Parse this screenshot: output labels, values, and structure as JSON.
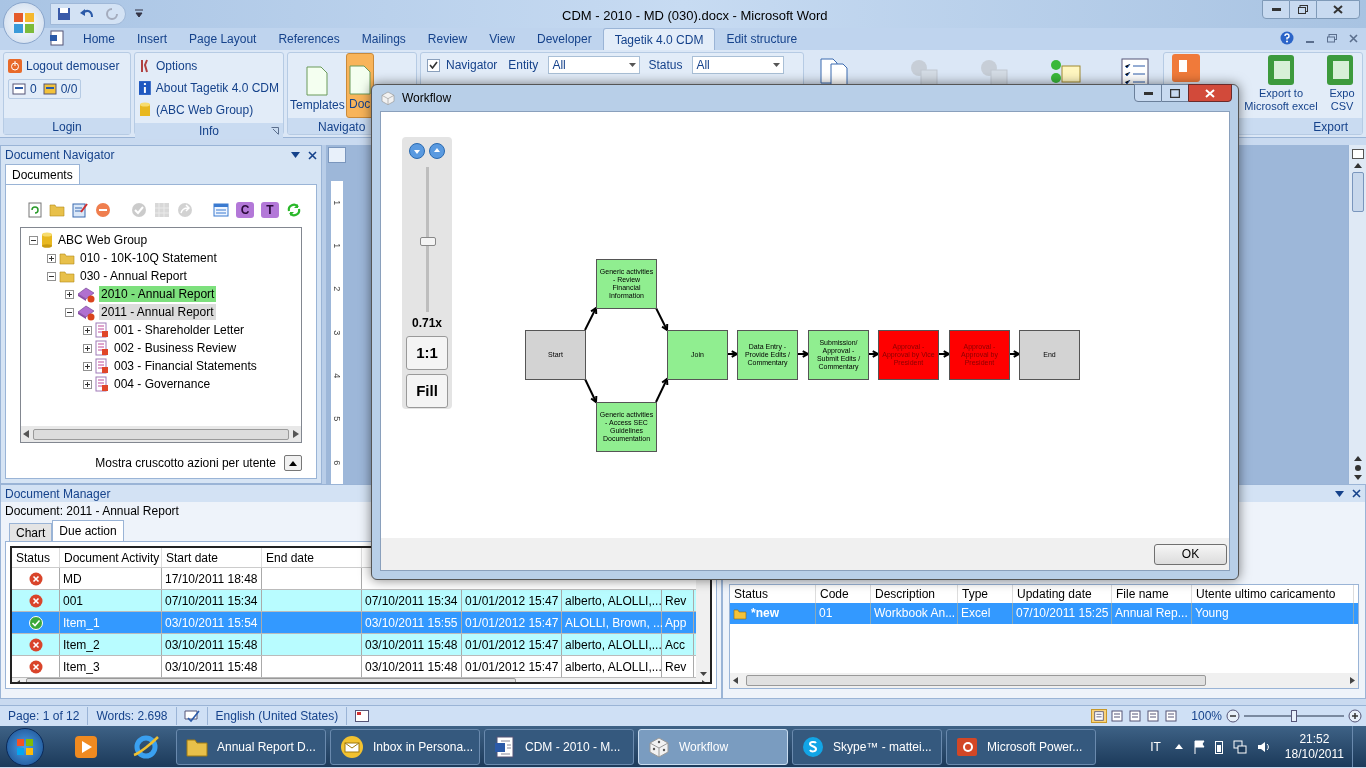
{
  "window": {
    "title": "CDM - 2010 - MD (030).docx - Microsoft Word"
  },
  "ribbon_tabs": [
    {
      "label": "Home",
      "selected": false
    },
    {
      "label": "Insert",
      "selected": false
    },
    {
      "label": "Page Layout",
      "selected": false
    },
    {
      "label": "References",
      "selected": false
    },
    {
      "label": "Mailings",
      "selected": false
    },
    {
      "label": "Review",
      "selected": false
    },
    {
      "label": "View",
      "selected": false
    },
    {
      "label": "Developer",
      "selected": false
    },
    {
      "label": "Tagetik 4.0 CDM",
      "selected": true
    },
    {
      "label": "Edit structure",
      "selected": false
    }
  ],
  "ribbon": {
    "login": {
      "logout": "Logout demouser",
      "counters": [
        "0",
        "0/0"
      ],
      "group": "Login"
    },
    "info": {
      "items": [
        "Options",
        "About Tagetik 4.0 CDM",
        "(ABC Web Group)"
      ],
      "group": "Info"
    },
    "navigator": {
      "buttons": [
        {
          "label": "Templates",
          "selected": false
        },
        {
          "label": "Doc",
          "selected": true
        }
      ],
      "group": "Navigato"
    },
    "filters": {
      "navigator": {
        "label": "Navigator",
        "checked": true
      },
      "entity": {
        "label": "Entity",
        "value": "All"
      },
      "status": {
        "label": "Status",
        "value": "All"
      }
    },
    "export": {
      "buttons": [
        "Export to Microsoft excel",
        "Expo CSV"
      ],
      "group": "Export"
    }
  },
  "document_navigator": {
    "title": "Document Navigator",
    "tabs": [
      {
        "label": "Documents",
        "selected": true
      }
    ],
    "toolbar": [
      {
        "kind": "refresh",
        "disabled": false
      },
      {
        "kind": "folder",
        "disabled": false
      },
      {
        "kind": "edit",
        "disabled": false
      },
      {
        "kind": "remove",
        "disabled": false
      },
      {
        "kind": "check",
        "disabled": true
      },
      {
        "kind": "grid",
        "disabled": true
      },
      {
        "kind": "forward",
        "disabled": true
      },
      {
        "kind": "list",
        "disabled": false
      },
      {
        "kind": "badge",
        "label": "C",
        "disabled": false
      },
      {
        "kind": "badge",
        "label": "T",
        "disabled": false
      },
      {
        "kind": "sync",
        "disabled": false
      }
    ],
    "tree": [
      {
        "label": "ABC Web Group",
        "kind": "database",
        "expanded": true,
        "selected": false,
        "highlighted": false,
        "children": [
          {
            "label": "010 - 10K-10Q Statement",
            "kind": "folder",
            "expanded": false,
            "selected": false,
            "highlighted": false
          },
          {
            "label": "030 - Annual Report",
            "kind": "folder",
            "expanded": true,
            "selected": false,
            "highlighted": false,
            "children": [
              {
                "label": "2010 - Annual Report",
                "kind": "report",
                "expanded": false,
                "selected": false,
                "highlighted": true
              },
              {
                "label": "2011 - Annual Report",
                "kind": "report",
                "expanded": true,
                "selected": true,
                "highlighted": false,
                "children": [
                  {
                    "label": "001 - Shareholder Letter",
                    "kind": "section",
                    "expanded": false,
                    "selected": false,
                    "highlighted": false
                  },
                  {
                    "label": "002 - Business Review",
                    "kind": "section",
                    "expanded": false,
                    "selected": false,
                    "highlighted": false
                  },
                  {
                    "label": "003 - Financial Statements",
                    "kind": "section",
                    "expanded": false,
                    "selected": false,
                    "highlighted": false
                  },
                  {
                    "label": "004 - Governance",
                    "kind": "section",
                    "expanded": false,
                    "selected": false,
                    "highlighted": false
                  }
                ]
              }
            ]
          }
        ]
      }
    ],
    "footer": "Mostra cruscotto azioni per utente"
  },
  "ruler": [
    "1",
    "1",
    "2",
    "3",
    "4",
    "5",
    "6"
  ],
  "document_manager": {
    "title": "Document Manager",
    "document": "Document: 2011 - Annual Report",
    "tabs": [
      {
        "label": "Chart",
        "selected": false
      },
      {
        "label": "Due action",
        "selected": true
      }
    ],
    "columns": [
      "Status",
      "Document Activity",
      "Start date",
      "End date"
    ],
    "rows": [
      {
        "kind": "error",
        "selected": false,
        "highlighted": false,
        "activity": "MD",
        "start": "17/10/2011 18:48"
      },
      {
        "kind": "error",
        "selected": false,
        "highlighted": true,
        "activity": "001",
        "start": "07/10/2011 15:34",
        "cells": [
          "07/10/2011 15:34",
          "01/01/2012 15:47",
          "alberto, ALOLLI,...",
          "Rev"
        ]
      },
      {
        "kind": "ok",
        "selected": true,
        "highlighted": false,
        "activity": "Item_1",
        "start": "03/10/2011 15:54",
        "cells": [
          "03/10/2011 15:55",
          "01/01/2012 15:47",
          "ALOLLI, Brown, ...",
          "App"
        ]
      },
      {
        "kind": "error",
        "selected": false,
        "highlighted": true,
        "activity": "Item_2",
        "start": "03/10/2011 15:48",
        "cells": [
          "03/10/2011 15:48",
          "01/01/2012 15:47",
          "alberto, ALOLLI,...",
          "Acc"
        ]
      },
      {
        "kind": "error",
        "selected": false,
        "highlighted": false,
        "activity": "Item_3",
        "start": "03/10/2011 15:48",
        "cells": [
          "03/10/2011 15:48",
          "01/01/2012 15:47",
          "alberto, ALOLLI,...",
          "Rev"
        ]
      }
    ],
    "files": {
      "columns": [
        "Status",
        "Code",
        "Description",
        "Type",
        "Updating date",
        "File name",
        "Utente ultimo caricamento"
      ],
      "rows": [
        {
          "selected": true,
          "cells": [
            "*new",
            "01",
            "Workbook An...",
            "Excel",
            "07/10/2011 15:25",
            "Annual Rep...",
            "Young"
          ]
        }
      ]
    }
  },
  "workflow_dialog": {
    "title": "Workflow",
    "zoom": {
      "level": 0.48,
      "reading": "0.71x",
      "buttons": [
        "1:1",
        "Fill"
      ]
    },
    "nodes": [
      {
        "label": "Start",
        "color": "#d3d3d3"
      },
      {
        "label": "Generic activities - Review Financial Information",
        "color": "#90ee90"
      },
      {
        "label": "Generic activities - Access SEC Guidelines Documentation",
        "color": "#90ee90"
      },
      {
        "label": "Join",
        "color": "#90ee90"
      },
      {
        "label": "Data Entry - Provide Edits / Commentary",
        "color": "#90ee90"
      },
      {
        "label": "Submission/ Approval - Submit Edits / Commentary",
        "color": "#90ee90"
      },
      {
        "label": "Approval - Approval by Vice President",
        "color": "#ff0000"
      },
      {
        "label": "Approval - Approval by President",
        "color": "#ff0000"
      },
      {
        "label": "End",
        "color": "#d3d3d3"
      }
    ],
    "ok": "OK"
  },
  "status_bar": {
    "page": "Page: 1 of 12",
    "words": "Words: 2.698",
    "language": "English (United States)",
    "zoom": "100%",
    "zoom_slider": {
      "level": 0.5
    }
  },
  "taskbar": {
    "items": [
      {
        "label": "Annual Report D...",
        "kind": "folder",
        "selected": false
      },
      {
        "label": "Inbox in Persona...",
        "kind": "mail",
        "selected": false
      },
      {
        "label": "CDM - 2010 - M...",
        "kind": "word",
        "selected": false
      },
      {
        "label": "Workflow",
        "kind": "dice",
        "selected": true
      },
      {
        "label": "Skype™ - mattei...",
        "kind": "skype",
        "selected": false
      },
      {
        "label": "Microsoft Power...",
        "kind": "powerpoint",
        "selected": false
      }
    ],
    "language": "IT",
    "time": "21:52",
    "date": "18/10/2011"
  }
}
